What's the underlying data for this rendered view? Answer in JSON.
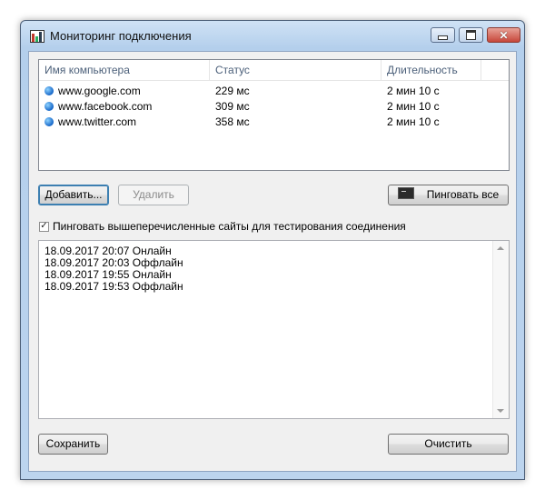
{
  "window": {
    "title": "Мониторинг подключения"
  },
  "list": {
    "columns": [
      "Имя компьютера",
      "Статус",
      "Длительность"
    ],
    "rows": [
      {
        "host": "www.google.com",
        "status": "229 мс",
        "duration": "2 мин 10 с"
      },
      {
        "host": "www.facebook.com",
        "status": "309 мс",
        "duration": "2 мин 10 с"
      },
      {
        "host": "www.twitter.com",
        "status": "358 мс",
        "duration": "2 мин 10 с"
      }
    ]
  },
  "buttons": {
    "add": "Добавить...",
    "remove": "Удалить",
    "ping_all": "Пинговать все",
    "save": "Сохранить",
    "clear": "Очистить"
  },
  "checkbox": {
    "label": "Пинговать вышеперечисленные сайты для тестирования соединения",
    "checked": true
  },
  "log": [
    "18.09.2017 20:07 Онлайн",
    "18.09.2017 20:03 Оффлайн",
    "18.09.2017 19:55 Онлайн",
    "18.09.2017 19:53 Оффлайн"
  ],
  "icons": {
    "app": "bar-chart-icon",
    "status": "globe-dot-icon",
    "ping": "terminal-icon"
  }
}
